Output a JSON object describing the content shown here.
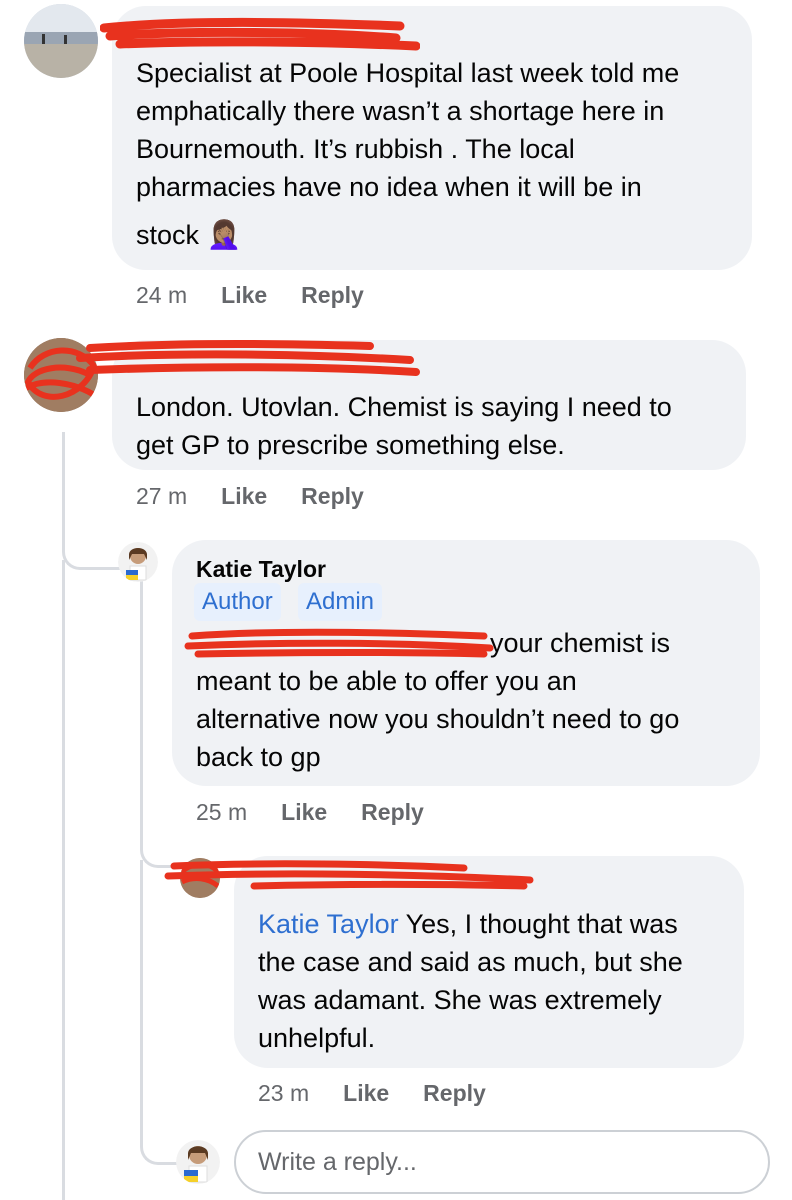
{
  "comments": [
    {
      "time": "24 m",
      "like": "Like",
      "reply": "Reply",
      "lines": [
        "Specialist at Poole Hospital last week told me",
        "emphatically there wasn’t a shortage here in",
        "Bournemouth. It’s rubbish . The local",
        "pharmacies have no idea when it will be in",
        "stock"
      ],
      "emoji": "🤦🏽‍♀️"
    },
    {
      "time": "27 m",
      "like": "Like",
      "reply": "Reply",
      "lines": [
        "London. Utovlan. Chemist is  saying I need to",
        "get GP to prescribe something else."
      ]
    },
    {
      "author": "Katie Taylor",
      "badges": [
        "Author",
        "Admin"
      ],
      "time": "25 m",
      "like": "Like",
      "reply": "Reply",
      "lines": [
        "your chemist is",
        "meant to be able to offer you an",
        "alternative now you shouldn’t  need to go",
        "back to gp"
      ]
    },
    {
      "mention": "Katie Taylor",
      "time": "23 m",
      "like": "Like",
      "reply": "Reply",
      "lines": [
        " Yes, I thought that was",
        "the case and said as much, but she",
        "was adamant. She was extremely",
        "unhelpful."
      ]
    }
  ],
  "reply_box": {
    "placeholder": "Write a reply..."
  },
  "colors": {
    "bubble": "#f0f2f5",
    "link": "#2e6fd0",
    "badge_bg": "#e7f0fd",
    "redaction": "#e8321e",
    "meta": "#65676b"
  }
}
